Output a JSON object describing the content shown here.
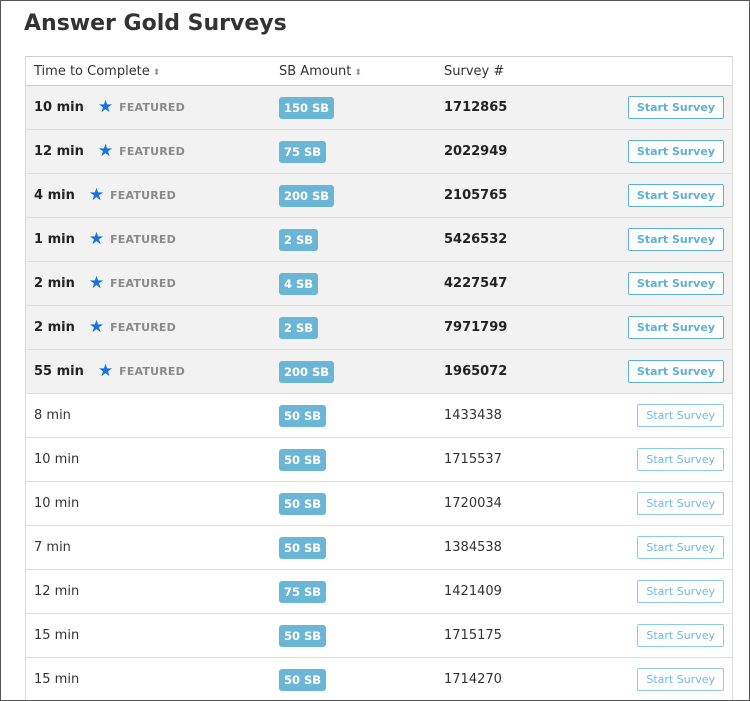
{
  "title": "Answer Gold Surveys",
  "columns": {
    "time": "Time to Complete",
    "sb": "SB Amount",
    "survey": "Survey #"
  },
  "sort_glyph": "⬍",
  "featured_label": "FEATURED",
  "button_label": "Start Survey",
  "rows": [
    {
      "time": "10 min",
      "featured": true,
      "sb": "150 SB",
      "survey": "1712865"
    },
    {
      "time": "12 min",
      "featured": true,
      "sb": "75 SB",
      "survey": "2022949"
    },
    {
      "time": "4 min",
      "featured": true,
      "sb": "200 SB",
      "survey": "2105765"
    },
    {
      "time": "1 min",
      "featured": true,
      "sb": "2 SB",
      "survey": "5426532"
    },
    {
      "time": "2 min",
      "featured": true,
      "sb": "4 SB",
      "survey": "4227547"
    },
    {
      "time": "2 min",
      "featured": true,
      "sb": "2 SB",
      "survey": "7971799"
    },
    {
      "time": "55 min",
      "featured": true,
      "sb": "200 SB",
      "survey": "1965072"
    },
    {
      "time": "8 min",
      "featured": false,
      "sb": "50 SB",
      "survey": "1433438"
    },
    {
      "time": "10 min",
      "featured": false,
      "sb": "50 SB",
      "survey": "1715537"
    },
    {
      "time": "10 min",
      "featured": false,
      "sb": "50 SB",
      "survey": "1720034"
    },
    {
      "time": "7 min",
      "featured": false,
      "sb": "50 SB",
      "survey": "1384538"
    },
    {
      "time": "12 min",
      "featured": false,
      "sb": "75 SB",
      "survey": "1421409"
    },
    {
      "time": "15 min",
      "featured": false,
      "sb": "50 SB",
      "survey": "1715175"
    },
    {
      "time": "15 min",
      "featured": false,
      "sb": "50 SB",
      "survey": "1714270"
    }
  ],
  "colors": {
    "star": "#1a73d9",
    "badge": "#6bb6d6",
    "button": "#5fb0d3",
    "featured_row_bg": "#f2f2f2"
  },
  "icons": {
    "star": "star-icon",
    "sort": "sort-icon"
  }
}
